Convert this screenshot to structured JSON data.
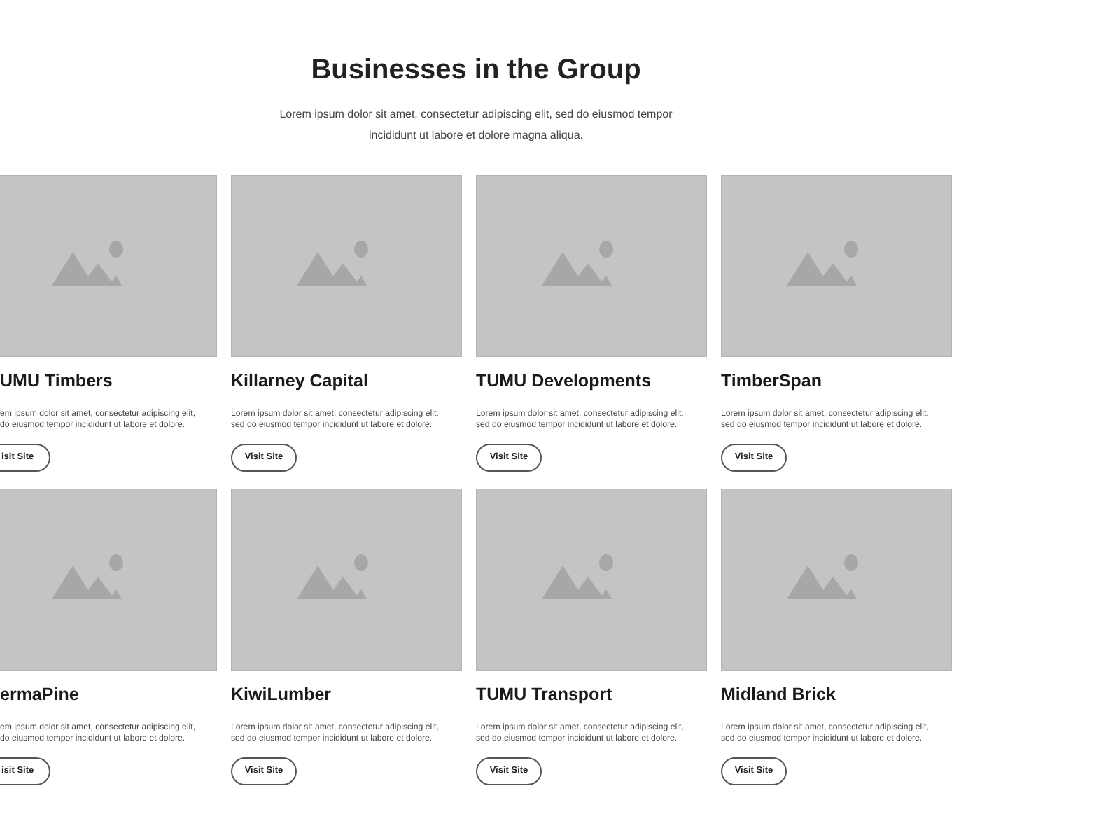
{
  "header": {
    "title": "Businesses in the Group",
    "subtitle": "Lorem ipsum dolor sit amet, consectetur adipiscing elit, sed do eiusmod tempor incididunt ut labore et dolore magna aliqua."
  },
  "businesses": [
    {
      "cut": true,
      "name": "UMU Timbers",
      "description_lines": [
        "em ipsum dolor sit amet, consectetur adipiscing elit,",
        "do eiusmod tempor incididunt ut labore et dolore."
      ],
      "button": "isit Site"
    },
    {
      "cut": false,
      "name": "Killarney Capital",
      "description_lines": [
        "Lorem ipsum dolor sit amet, consectetur adipiscing elit,",
        "sed do eiusmod tempor incididunt ut labore et dolore."
      ],
      "button": "Visit Site"
    },
    {
      "cut": false,
      "name": "TUMU Developments",
      "description_lines": [
        "Lorem ipsum dolor sit amet, consectetur adipiscing elit,",
        "sed do eiusmod tempor incididunt ut labore et dolore."
      ],
      "button": "Visit Site"
    },
    {
      "cut": false,
      "name": "TimberSpan",
      "description_lines": [
        "Lorem ipsum dolor sit amet, consectetur adipiscing elit,",
        "sed do eiusmod tempor incididunt ut labore et dolore."
      ],
      "button": "Visit Site"
    },
    {
      "cut": true,
      "name": "ermaPine",
      "description_lines": [
        "em ipsum dolor sit amet, consectetur adipiscing elit,",
        "do eiusmod tempor incididunt ut labore et dolore."
      ],
      "button": "isit Site"
    },
    {
      "cut": false,
      "name": "KiwiLumber",
      "description_lines": [
        "Lorem ipsum dolor sit amet, consectetur adipiscing elit,",
        "sed do eiusmod tempor incididunt ut labore et dolore."
      ],
      "button": "Visit Site"
    },
    {
      "cut": false,
      "name": "TUMU Transport",
      "description_lines": [
        "Lorem ipsum dolor sit amet, consectetur adipiscing elit,",
        "sed do eiusmod tempor incididunt ut labore et dolore."
      ],
      "button": "Visit Site"
    },
    {
      "cut": false,
      "name": "Midland Brick",
      "description_lines": [
        "Lorem ipsum dolor sit amet, consectetur adipiscing elit,",
        "sed do eiusmod tempor incididunt ut labore et dolore."
      ],
      "button": "Visit Site"
    }
  ]
}
